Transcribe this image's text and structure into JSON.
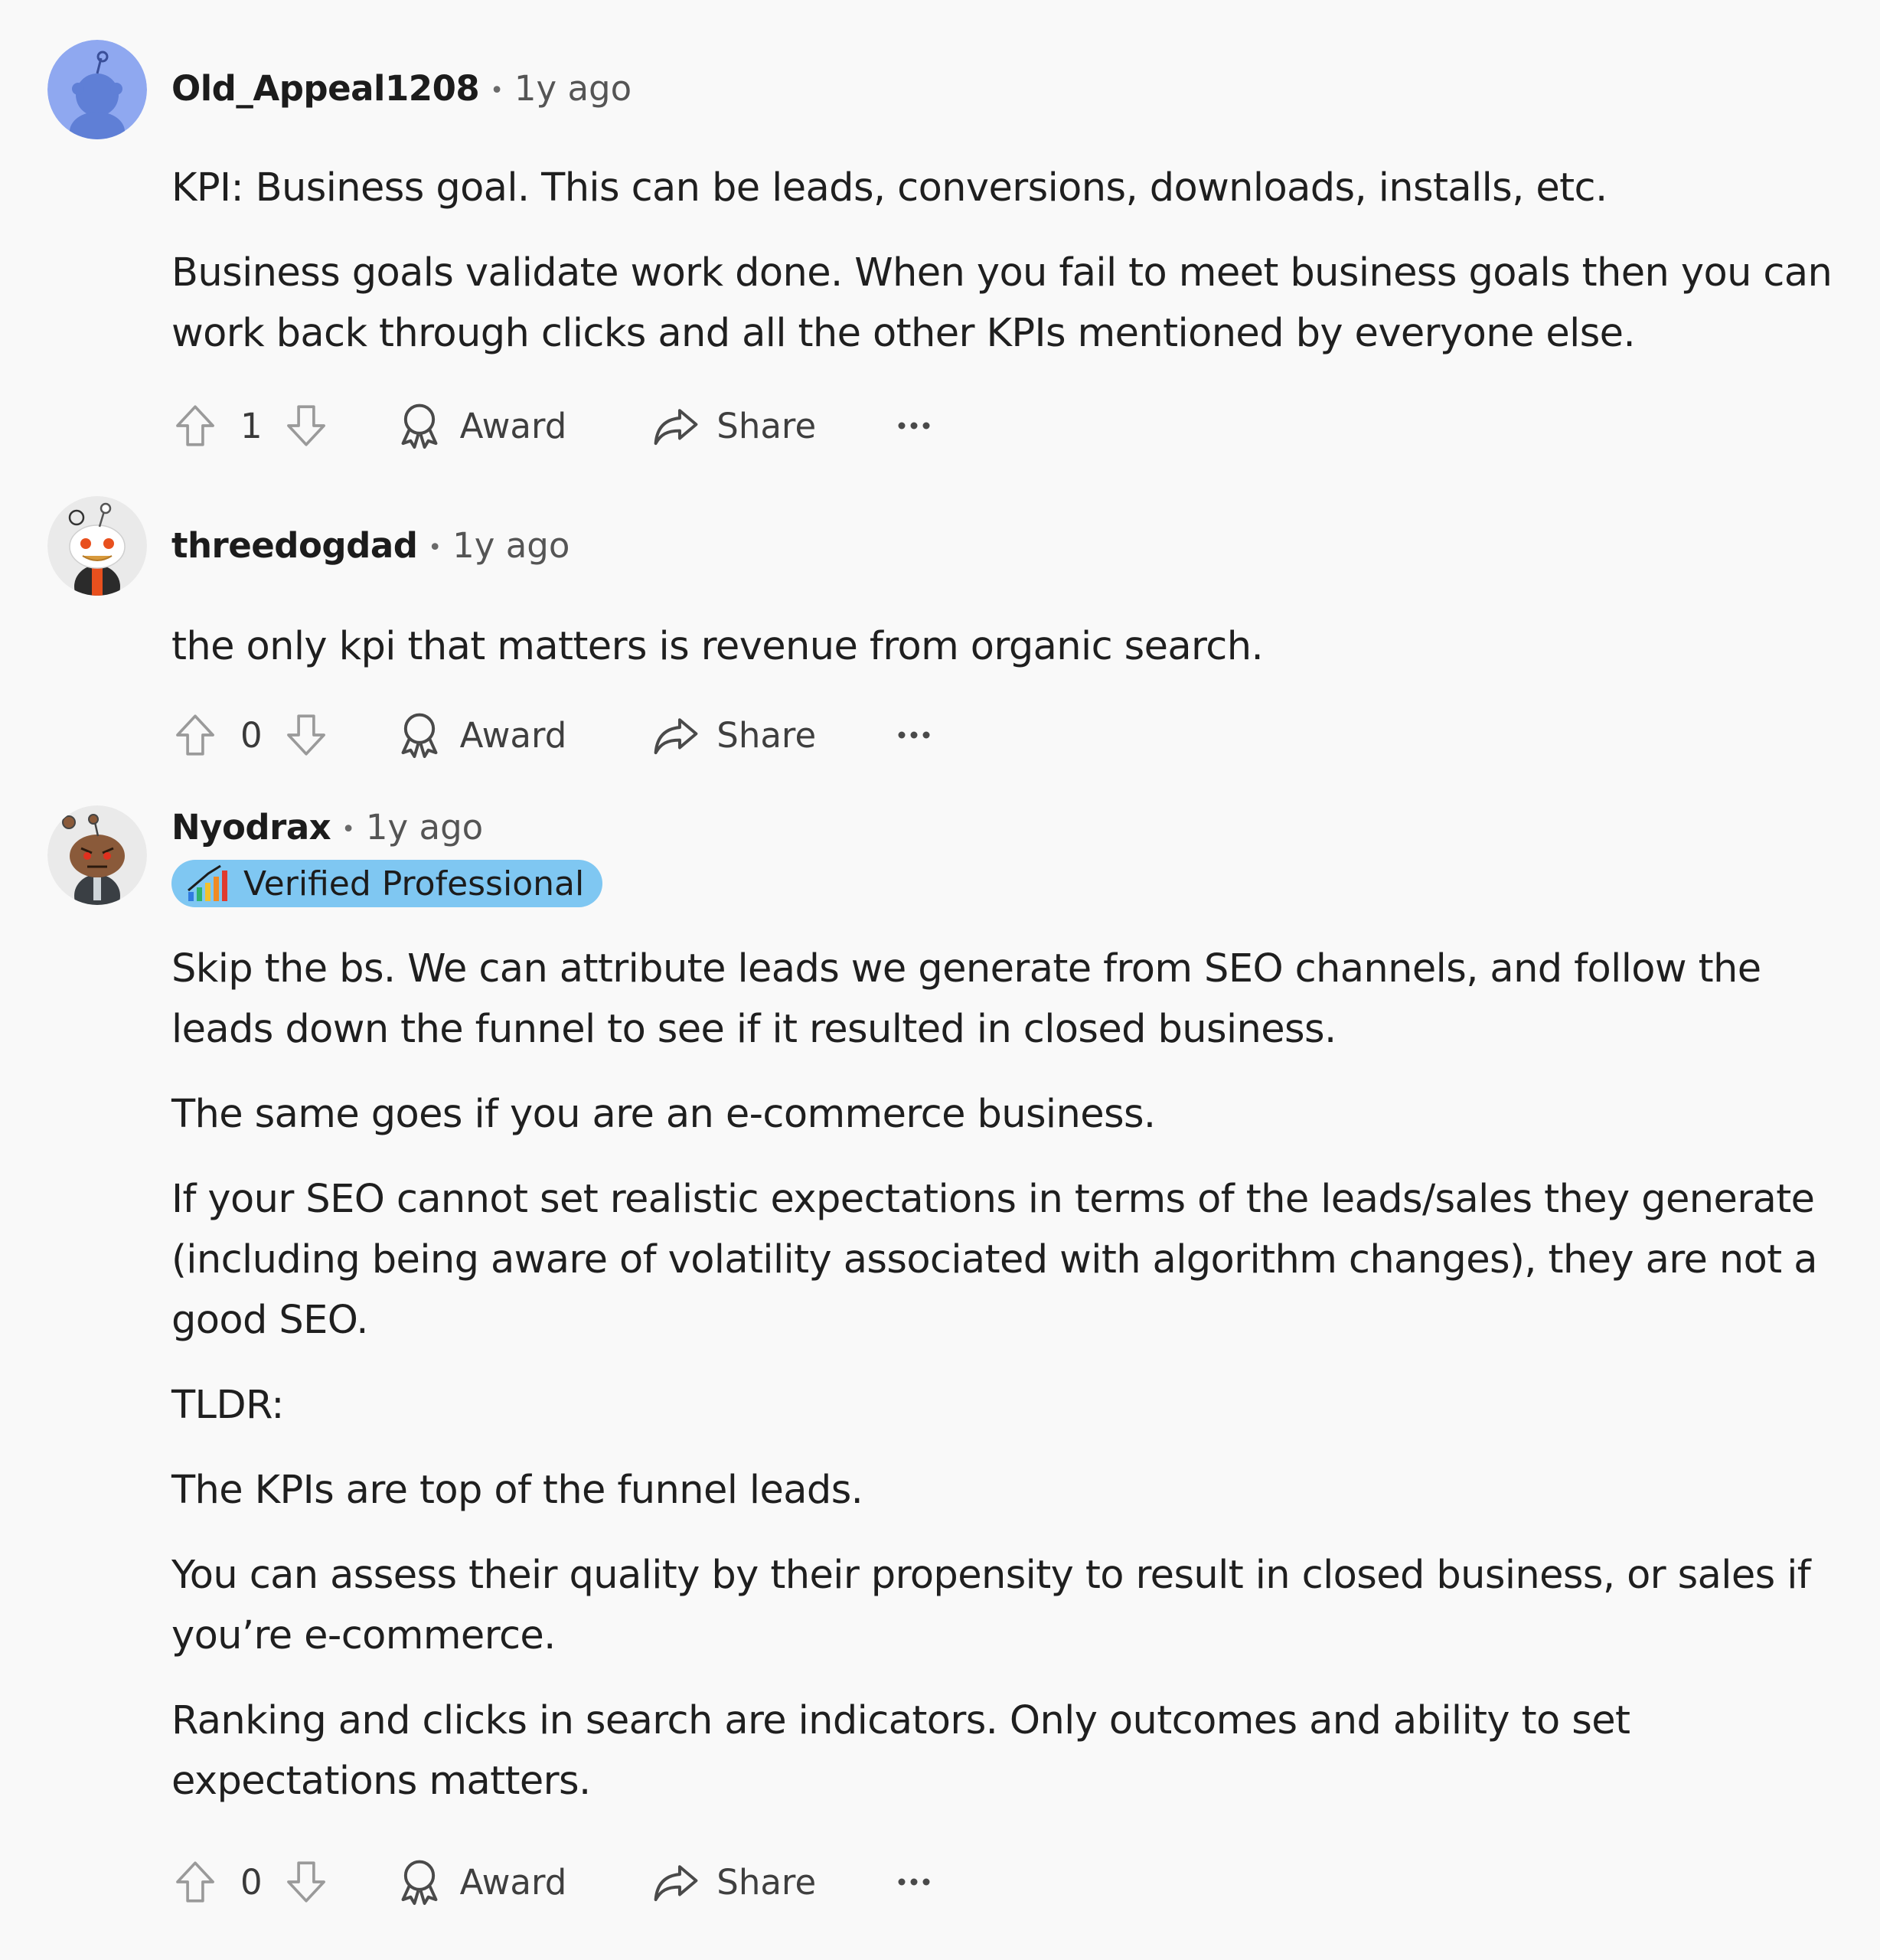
{
  "comments": [
    {
      "author": "Old_Appeal1208",
      "separator": "•",
      "time": "1y ago",
      "paragraphs": [
        "KPI: Business goal. This can be leads, conversions, downloads, installs, etc.",
        "Business goals validate work done. When you fail to meet business goals then you can work back through clicks and all the other KPIs mentioned by everyone else."
      ],
      "votes": "1",
      "award_label": "Award",
      "share_label": "Share"
    },
    {
      "author": "threedogdad",
      "separator": "•",
      "time": "1y ago",
      "paragraphs": [
        "the only kpi that matters is revenue from organic search."
      ],
      "votes": "0",
      "award_label": "Award",
      "share_label": "Share"
    },
    {
      "author": "Nyodrax",
      "separator": "•",
      "time": "1y ago",
      "flair": "Verified Professional",
      "paragraphs": [
        "Skip the bs. We can attribute leads we generate from SEO channels, and follow the leads down the funnel to see if it resulted in closed business.",
        "The same goes if you are an e-commerce business.",
        "If your SEO cannot set realistic expectations in terms of the leads/sales they generate (including being aware of volatility associated with algorithm changes), they are not a good SEO.",
        "TLDR:",
        "The KPIs are top of the funnel leads.",
        "You can assess their quality by their propensity to result in closed business, or sales if you’re e-commerce.",
        "Ranking and clicks in search are indicators. Only outcomes and ability to set expectations matters."
      ],
      "votes": "0",
      "award_label": "Award",
      "share_label": "Share"
    }
  ],
  "icons": {
    "upvote": "arrow-up-icon",
    "downvote": "arrow-down-icon",
    "award": "award-icon",
    "share": "share-icon",
    "more": "more-icon",
    "flair": "chart-bars-icon"
  },
  "colors": {
    "background": "#f9f9f9",
    "flair_background": "#7fc7f2",
    "avatar_default_bg": "#8fa8f0"
  }
}
